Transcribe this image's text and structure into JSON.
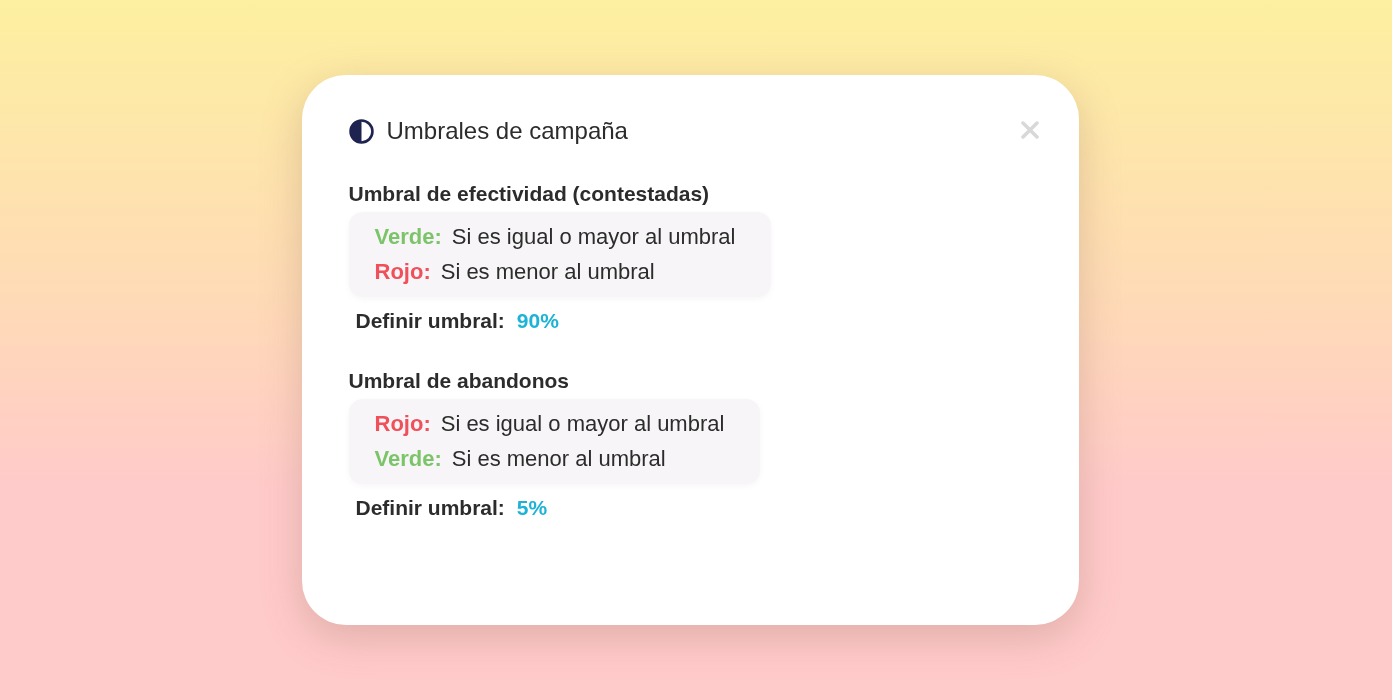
{
  "dialog": {
    "title": "Umbrales de campaña"
  },
  "sections": [
    {
      "heading": "Umbral de efectividad (contestadas)",
      "rules": [
        {
          "label": "Verde:",
          "text": "Si es igual o mayor al umbral",
          "color": "#7cc469"
        },
        {
          "label": "Rojo:",
          "text": "Si es menor al umbral",
          "color": "#f0505a"
        }
      ],
      "define_label": "Definir umbral:",
      "value": "90%"
    },
    {
      "heading": "Umbral de abandonos",
      "rules": [
        {
          "label": "Rojo:",
          "text": "Si es igual o mayor al umbral",
          "color": "#f0505a"
        },
        {
          "label": "Verde:",
          "text": "Si es menor al umbral",
          "color": "#7cc469"
        }
      ],
      "define_label": "Definir umbral:",
      "value": "5%"
    }
  ]
}
